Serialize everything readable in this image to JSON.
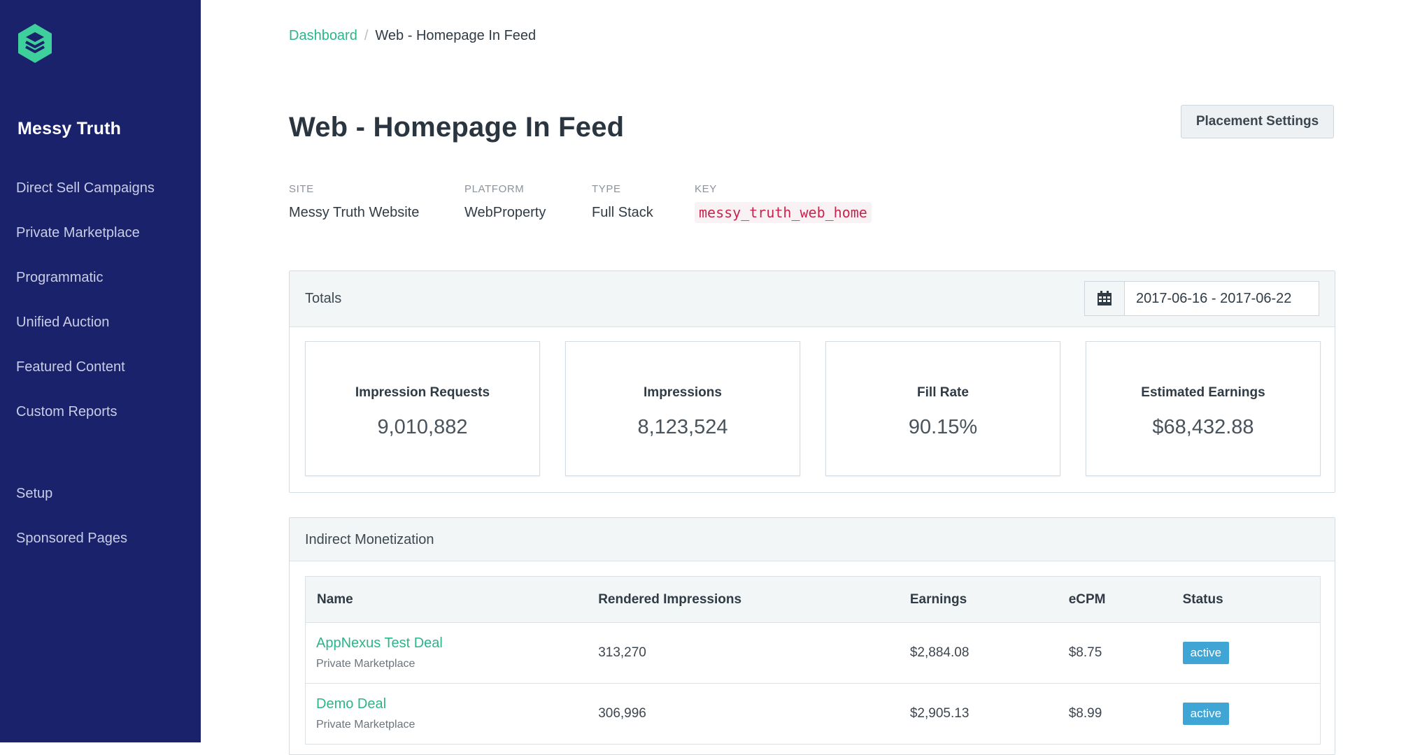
{
  "sidebar": {
    "brand": "Messy Truth",
    "items": [
      {
        "label": "Direct Sell Campaigns"
      },
      {
        "label": "Private Marketplace"
      },
      {
        "label": "Programmatic"
      },
      {
        "label": "Unified Auction"
      },
      {
        "label": "Featured Content"
      },
      {
        "label": "Custom Reports"
      },
      {
        "label": "Setup"
      },
      {
        "label": "Sponsored Pages"
      }
    ]
  },
  "breadcrumb": {
    "root": "Dashboard",
    "separator": "/",
    "current": "Web - Homepage In Feed"
  },
  "page": {
    "title": "Web - Homepage In Feed",
    "settings_button": "Placement Settings"
  },
  "meta": {
    "site": {
      "label": "SITE",
      "value": "Messy Truth Website"
    },
    "platform": {
      "label": "PLATFORM",
      "value": "WebProperty"
    },
    "type": {
      "label": "TYPE",
      "value": "Full Stack"
    },
    "key": {
      "label": "KEY",
      "value": "messy_truth_web_home"
    }
  },
  "totals": {
    "title": "Totals",
    "date_range": "2017-06-16 - 2017-06-22",
    "stats": [
      {
        "label": "Impression Requests",
        "value": "9,010,882"
      },
      {
        "label": "Impressions",
        "value": "8,123,524"
      },
      {
        "label": "Fill Rate",
        "value": "90.15%"
      },
      {
        "label": "Estimated Earnings",
        "value": "$68,432.88"
      }
    ]
  },
  "indirect": {
    "title": "Indirect Monetization",
    "columns": {
      "name": "Name",
      "rendered": "Rendered Impressions",
      "earnings": "Earnings",
      "ecpm": "eCPM",
      "status": "Status"
    },
    "rows": [
      {
        "name": "AppNexus Test Deal",
        "type": "Private Marketplace",
        "rendered": "313,270",
        "earnings": "$2,884.08",
        "ecpm": "$8.75",
        "status": "active"
      },
      {
        "name": "Demo Deal",
        "type": "Private Marketplace",
        "rendered": "306,996",
        "earnings": "$2,905.13",
        "ecpm": "$8.99",
        "status": "active"
      }
    ]
  },
  "colors": {
    "sidebar_bg": "#19226b",
    "accent_green": "#2bb58a",
    "badge_blue": "#3ea5d4",
    "key_code": "#c7254e"
  },
  "icons": {
    "logo": "hexagon-layers-logo",
    "calendar": "calendar-icon"
  }
}
